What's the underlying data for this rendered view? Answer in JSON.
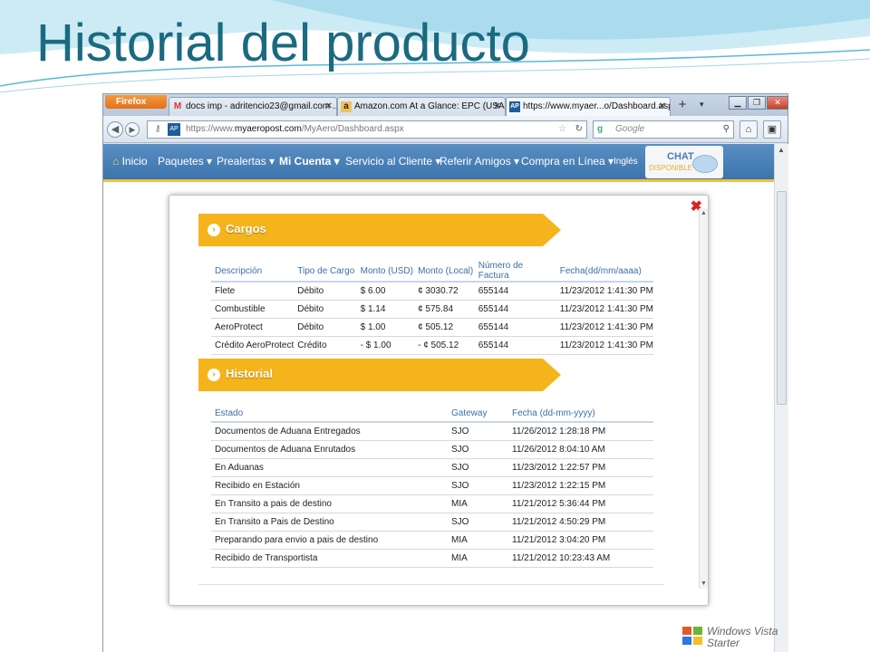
{
  "slide": {
    "title": "Historial del producto"
  },
  "browser": {
    "app_button": "Firefox",
    "tabs": [
      {
        "label": "docs imp - adritencio23@gmail.com ...",
        "icon": "gmail-icon",
        "active": false
      },
      {
        "label": "Amazon.com At a Glance: EPC (USA) ...",
        "icon": "amazon-icon",
        "active": false
      },
      {
        "label": "https://www.myaer...o/Dashboard.aspx",
        "icon": "aeropost-icon",
        "active": true
      }
    ],
    "new_tab": "+",
    "url_prefix": "https://www.",
    "url_domain": "myaeropost.com",
    "url_path": "/MyAero/Dashboard.aspx",
    "search_placeholder": "Google"
  },
  "site_nav": {
    "items": [
      "Inicio",
      "Paquetes ▾",
      "Prealertas ▾",
      "Mi Cuenta ▾",
      "Servicio al Cliente ▾",
      "Referir Amigos ▾",
      "Compra en Línea ▾",
      "Inglés"
    ],
    "chat_label": "CHAT",
    "chat_status": "DISPONIBLE"
  },
  "cargos": {
    "title": "Cargos",
    "headers": [
      "Descripción",
      "Tipo de Cargo",
      "Monto (USD)",
      "Monto (Local)",
      "Número de Factura",
      "Fecha(dd/mm/aaaa)"
    ],
    "rows": [
      [
        "Flete",
        "Débito",
        "$ 6.00",
        "¢ 3030.72",
        "655144",
        "11/23/2012 1:41:30 PM"
      ],
      [
        "Combustible",
        "Débito",
        "$ 1.14",
        "¢ 575.84",
        "655144",
        "11/23/2012 1:41:30 PM"
      ],
      [
        "AeroProtect",
        "Débito",
        "$ 1.00",
        "¢ 505.12",
        "655144",
        "11/23/2012 1:41:30 PM"
      ],
      [
        "Crédito AeroProtect",
        "Crédito",
        "- $ 1.00",
        "- ¢ 505.12",
        "655144",
        "11/23/2012 1:41:30 PM"
      ]
    ]
  },
  "historial": {
    "title": "Historial",
    "headers": [
      "Estado",
      "Gateway",
      "Fecha (dd-mm-yyyy)"
    ],
    "rows": [
      [
        "Documentos de Aduana Entregados",
        "SJO",
        "11/26/2012 1:28:18 PM"
      ],
      [
        "Documentos de Aduana Enrutados",
        "SJO",
        "11/26/2012 8:04:10 AM"
      ],
      [
        "En Aduanas",
        "SJO",
        "11/23/2012 1:22:57 PM"
      ],
      [
        "Recibido en Estación",
        "SJO",
        "11/23/2012 1:22:15 PM"
      ],
      [
        "En Transito a pais de destino",
        "MIA",
        "11/21/2012 5:36:44 PM"
      ],
      [
        "En Transito a Pais de Destino",
        "SJO",
        "11/21/2012 4:50:29 PM"
      ],
      [
        "Preparando para envio a pais de destino",
        "MIA",
        "11/21/2012 3:04:20 PM"
      ],
      [
        "Recibido de Transportista",
        "MIA",
        "11/21/2012 10:23:43 AM"
      ]
    ]
  },
  "os_logo": {
    "line1": "Windows Vista",
    "line2": "Starter"
  },
  "colors": {
    "title": "#1a6a80",
    "banner": "#f5b41c",
    "nav": "#3b74ad",
    "header_text": "#3b6fa8"
  }
}
